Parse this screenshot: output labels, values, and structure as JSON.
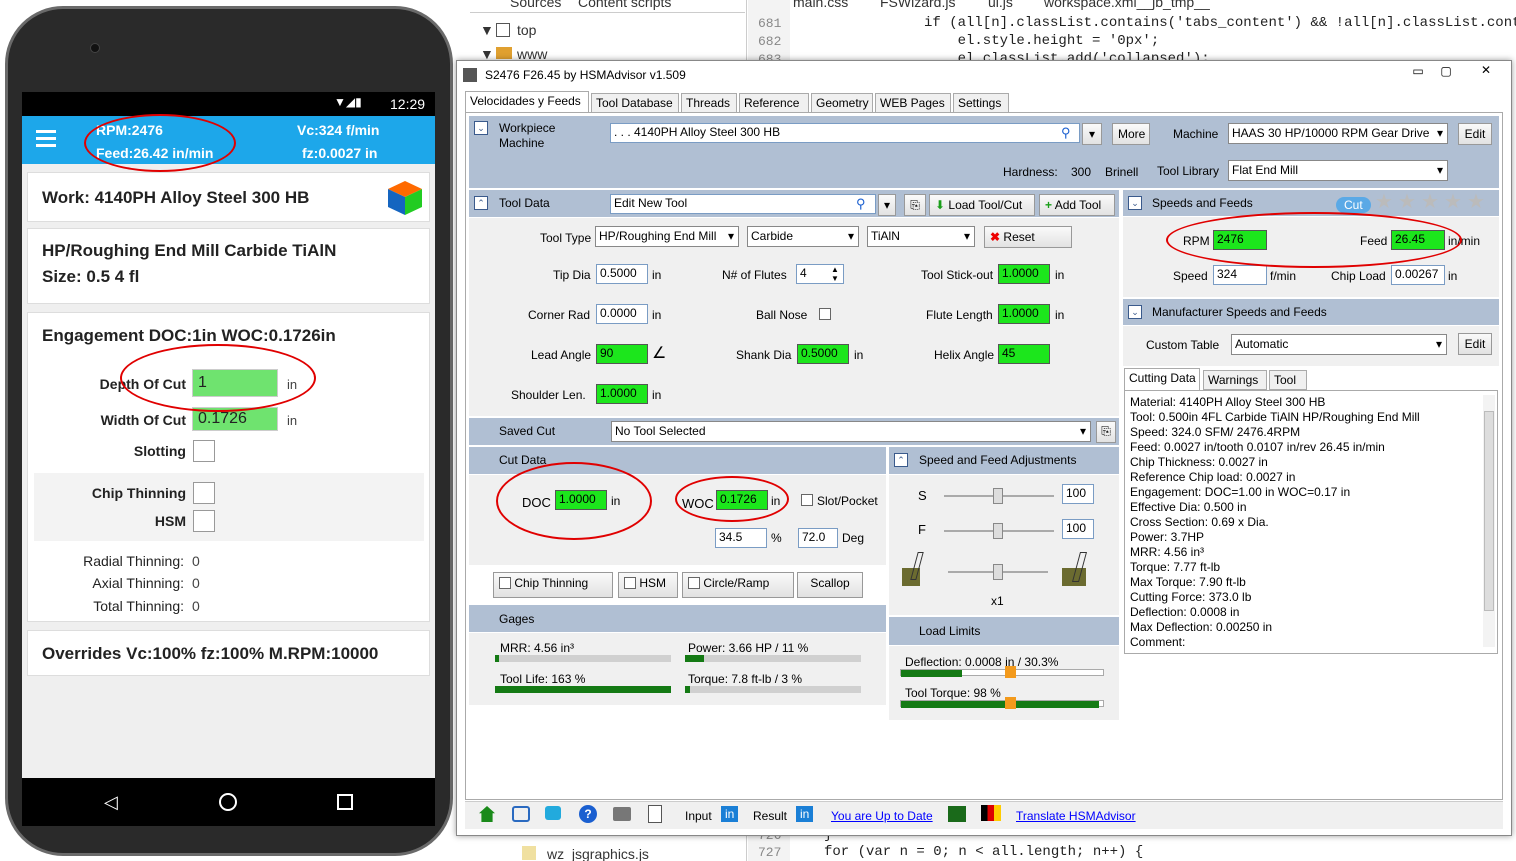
{
  "devtools": {
    "tabs": [
      "Sources",
      "Content scripts"
    ],
    "files_top": [
      "main.css",
      "FSWizard.js",
      "ui.js",
      "workspace.xml__jb_tmp__"
    ],
    "tree": [
      "top",
      "www",
      "wz_jsgraphics.js"
    ],
    "line_numbers": [
      "681",
      "682",
      "683",
      "726",
      "727"
    ],
    "code": [
      "if (all[n].classList.contains('tabs_content') && !all[n].classList.conta",
      "    el.style.height = '0px';",
      "    el.classList.add('collapsed');",
      "}",
      "for (var n = 0; n < all.length; n++) {"
    ]
  },
  "phone": {
    "time": "12:29",
    "rpm": "RPM:2476",
    "feed": "Feed:26.42 in/min",
    "vc": "Vc:324 f/min",
    "fz": "fz:0.0027 in",
    "work": "Work: 4140PH Alloy Steel 300 HB",
    "tool": "HP/Roughing End Mill Carbide TiAlN",
    "size": "Size: 0.5 4 fl",
    "engagement": "Engagement DOC:1in WOC:0.1726in",
    "doc_label": "Depth Of Cut",
    "doc_value": "1",
    "woc_label": "Width Of Cut",
    "woc_value": "0.1726",
    "unit": "in",
    "slotting": "Slotting",
    "chip_thinning": "Chip Thinning",
    "hsm": "HSM",
    "radial": "Radial Thinning:",
    "radial_v": "0",
    "axial": "Axial Thinning:",
    "axial_v": "0",
    "total": "Total Thinning:",
    "total_v": "0",
    "overrides": "Overrides Vc:100% fz:100% M.RPM:10000"
  },
  "win": {
    "title": "S2476 F26.45 by HSMAdvisor v1.509",
    "tabs": [
      "Velocidades y Feeds",
      "Tool Database",
      "Threads",
      "Reference",
      "Geometry",
      "WEB Pages",
      "Settings"
    ],
    "workpiece_hdr": "Workpiece",
    "machine_hdr": "Machine",
    "material": ". . . 4140PH Alloy Steel 300 HB",
    "more": "More",
    "machine_label": "Machine",
    "machine": "HAAS 30 HP/10000 RPM Gear Drive",
    "edit": "Edit",
    "hardness_label": "Hardness:",
    "hardness": "300",
    "hardness_unit": "Brinell",
    "toollib_label": "Tool Library",
    "toollib": "Flat End Mill",
    "tooldata_hdr": "Tool Data",
    "tool_name": "Edit New Tool",
    "load_tool": "Load Tool/Cut",
    "add_tool": "Add Tool",
    "tooltype_label": "Tool Type",
    "tooltype": "HP/Roughing End Mill",
    "material_tool": "Carbide",
    "coating": "TiAlN",
    "reset": "Reset",
    "tipdia_label": "Tip Dia",
    "tipdia": "0.5000",
    "flutes_label": "N# of Flutes",
    "flutes": "4",
    "stickout_label": "Tool Stick-out",
    "stickout": "1.0000",
    "cornerrad_label": "Corner Rad",
    "cornerrad": "0.0000",
    "ballnose_label": "Ball Nose",
    "flutelen_label": "Flute Length",
    "flutelen": "1.0000",
    "leadangle_label": "Lead Angle",
    "leadangle": "90",
    "shankdia_label": "Shank Dia",
    "shankdia": "0.5000",
    "helix_label": "Helix Angle",
    "helix": "45",
    "shoulder_label": "Shoulder Len.",
    "shoulder": "1.0000",
    "in": "in",
    "savedcut_label": "Saved Cut",
    "savedcut": "No Tool Selected",
    "cutdata_hdr": "Cut Data",
    "doc_label": "DOC",
    "doc": "1.0000",
    "woc_label": "WOC",
    "woc": "0.1726",
    "slot_label": "Slot/Pocket",
    "pct": "34.5",
    "pct_unit": "%",
    "deg": "72.0",
    "deg_unit": "Deg",
    "chipthin": "Chip Thinning",
    "hsm": "HSM",
    "circle": "Circle/Ramp",
    "scallop": "Scallop",
    "sfa_hdr": "Speed and Feed Adjustments",
    "s_label": "S",
    "s_val": "100",
    "f_label": "F",
    "f_val": "100",
    "x1": "x1",
    "gages_hdr": "Gages",
    "mrr": "MRR: 4.56 in³",
    "power": "Power: 3.66 HP / 11 %",
    "toollife": "Tool Life: 163 %",
    "torque": "Torque: 7.8 ft-lb / 3 %",
    "loadlim_hdr": "Load Limits",
    "deflection": "Deflection: 0.0008 in / 30.3%",
    "tooltorque": "Tool Torque: 98 %",
    "sf_hdr": "Speeds and Feeds",
    "cut_badge": "Cut",
    "rpm_label": "RPM",
    "rpm": "2476",
    "feed_label": "Feed",
    "feed": "26.45",
    "feed_unit": "in/min",
    "speed_label": "Speed",
    "speed": "324",
    "speed_unit": "f/min",
    "chipload_label": "Chip Load",
    "chipload": "0.00267",
    "msf_hdr": "Manufacturer Speeds and Feeds",
    "custom_label": "Custom Table",
    "custom": "Automatic",
    "res_tabs": [
      "Cutting Data",
      "Warnings",
      "Tool"
    ],
    "results": [
      "Material: 4140PH Alloy Steel 300 HB",
      "Tool: 0.500in 4FL Carbide TiAlN HP/Roughing End Mill",
      "Speed: 324.0 SFM/ 2476.4RPM",
      "Feed: 0.0027 in/tooth 0.0107 in/rev 26.45 in/min",
      "Chip Thickness: 0.0027 in",
      "Reference Chip load: 0.0027 in",
      "Engagement: DOC=1.00 in  WOC=0.17 in",
      "Effective Dia: 0.500 in",
      "Cross Section: 0.69 x Dia.",
      "Power: 3.7HP",
      "MRR: 4.56 in³",
      "Torque: 7.77 ft-lb",
      "Max Torque: 7.90 ft-lb",
      "Cutting Force: 373.0 lb",
      "Deflection: 0.0008 in",
      "Max Deflection: 0.00250 in",
      "Comment:"
    ],
    "input_label": "Input",
    "result_label": "Result",
    "in_badge": "in",
    "uptodate": "You are Up to Date",
    "translate": "Translate HSMAdvisor"
  },
  "gauges": {
    "mrr": 0.02,
    "power": 0.11,
    "toollife": 1.0,
    "torque": 0.03,
    "deflection": 0.303,
    "tooltorque": 0.98
  }
}
